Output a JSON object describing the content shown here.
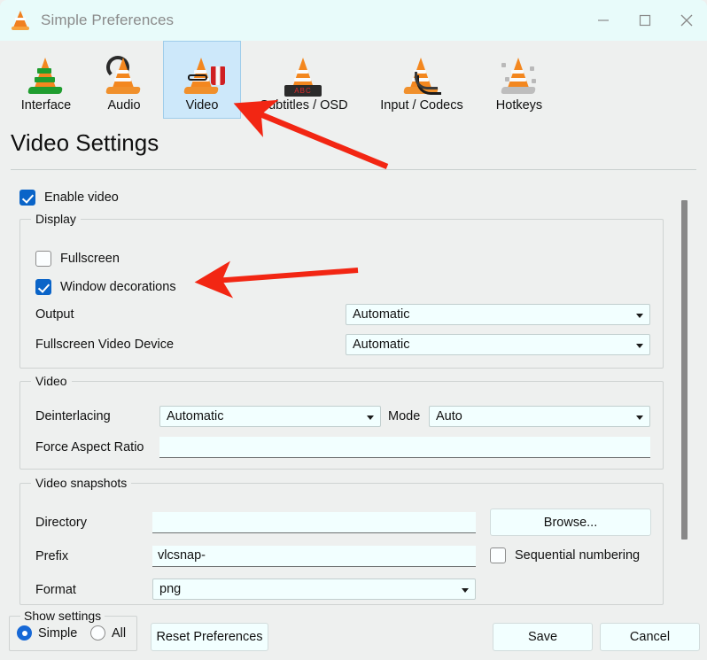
{
  "window": {
    "title": "Simple Preferences",
    "app_icon": "vlc-cone-icon",
    "controls": {
      "minimize": "minimize-icon",
      "maximize": "maximize-icon",
      "close": "close-icon"
    }
  },
  "tabs": [
    {
      "id": "interface",
      "label": "Interface",
      "icon": "vlc-interface-icon",
      "selected": false
    },
    {
      "id": "audio",
      "label": "Audio",
      "icon": "vlc-audio-icon",
      "selected": false
    },
    {
      "id": "video",
      "label": "Video",
      "icon": "vlc-video-icon",
      "selected": true
    },
    {
      "id": "subtitles",
      "label": "Subtitles / OSD",
      "icon": "vlc-subtitles-icon",
      "selected": false
    },
    {
      "id": "input",
      "label": "Input / Codecs",
      "icon": "vlc-input-icon",
      "selected": false
    },
    {
      "id": "hotkeys",
      "label": "Hotkeys",
      "icon": "vlc-hotkeys-icon",
      "selected": false
    }
  ],
  "page": {
    "heading": "Video Settings",
    "enable_video": {
      "label": "Enable video",
      "checked": true
    },
    "display_group": {
      "title": "Display",
      "fullscreen": {
        "label": "Fullscreen",
        "checked": false
      },
      "window_decorations": {
        "label": "Window decorations",
        "checked": true
      },
      "output": {
        "label": "Output",
        "value": "Automatic"
      },
      "fullscreen_video_device": {
        "label": "Fullscreen Video Device",
        "value": "Automatic"
      }
    },
    "video_group": {
      "title": "Video",
      "deinterlacing": {
        "label": "Deinterlacing",
        "value": "Automatic"
      },
      "mode": {
        "label": "Mode",
        "value": "Auto"
      },
      "force_aspect_ratio": {
        "label": "Force Aspect Ratio",
        "value": "",
        "placeholder": ""
      }
    },
    "snapshots_group": {
      "title": "Video snapshots",
      "directory": {
        "label": "Directory",
        "value": "",
        "placeholder": ""
      },
      "browse_button": "Browse...",
      "prefix": {
        "label": "Prefix",
        "value": "vlcsnap-"
      },
      "sequential_numbering": {
        "label": "Sequential numbering",
        "checked": false
      },
      "format": {
        "label": "Format",
        "value": "png"
      }
    }
  },
  "bottom": {
    "show_settings": {
      "title": "Show settings",
      "simple": {
        "label": "Simple",
        "selected": true
      },
      "all": {
        "label": "All",
        "selected": false
      }
    },
    "reset_button": "Reset Preferences",
    "save_button": "Save",
    "cancel_button": "Cancel"
  },
  "annotations": {
    "arrow_color": "#f22613",
    "arrow_1_target": "video-tab",
    "arrow_2_target": "window-decorations-checkbox"
  },
  "colors": {
    "titlebar_bg": "#e8fbfa",
    "dialog_bg": "#eef0ef",
    "field_bg": "#f2ffff",
    "accent_checked": "#0a64c8",
    "tab_selected_bg": "#cde8fa",
    "scrollbar_thumb": "#888888"
  },
  "osd_text": "ABC"
}
